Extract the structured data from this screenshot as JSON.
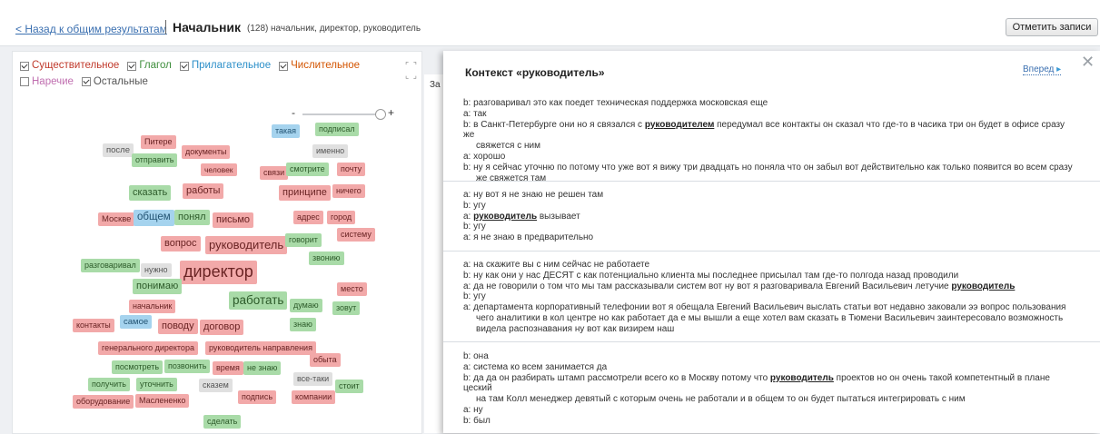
{
  "header": {
    "back_label": "< Назад к общим результатам",
    "title": "Начальник",
    "count": "(128)",
    "synonyms": "начальник, директор, руководитель",
    "mark_button": "Отметить записи"
  },
  "filters": [
    {
      "label": "Существительное",
      "checked": true,
      "color": "#c0392b"
    },
    {
      "label": "Глагол",
      "checked": true,
      "color": "#3e8e3c"
    },
    {
      "label": "Прилагательное",
      "checked": true,
      "color": "#2c8fc9"
    },
    {
      "label": "Числительное",
      "checked": true,
      "color": "#d35400"
    },
    {
      "label": "Наречие",
      "checked": false,
      "color": "#c06fb0"
    },
    {
      "label": "Остальные",
      "checked": true,
      "color": "#555555"
    }
  ],
  "zoom": {
    "minus": "-",
    "plus": "+"
  },
  "cloud": {
    "tags": [
      {
        "text": "такая",
        "color": "blue"
      },
      {
        "text": "подписал",
        "color": "green"
      },
      {
        "text": "Питере",
        "color": "pink"
      },
      {
        "text": "после",
        "color": "gray"
      },
      {
        "text": "документы",
        "color": "pink"
      },
      {
        "text": "именно",
        "color": "gray"
      },
      {
        "text": "отправить",
        "color": "green"
      },
      {
        "text": "человек",
        "color": "pink"
      },
      {
        "text": "связи",
        "color": "pink"
      },
      {
        "text": "смотрите",
        "color": "green"
      },
      {
        "text": "почту",
        "color": "pink"
      },
      {
        "text": "сказать",
        "color": "green"
      },
      {
        "text": "работы",
        "color": "pink"
      },
      {
        "text": "принципе",
        "color": "pink"
      },
      {
        "text": "ничего",
        "color": "pink"
      },
      {
        "text": "Москве",
        "color": "pink"
      },
      {
        "text": "общем",
        "color": "blue"
      },
      {
        "text": "понял",
        "color": "green"
      },
      {
        "text": "письмо",
        "color": "pink"
      },
      {
        "text": "адрес",
        "color": "pink"
      },
      {
        "text": "город",
        "color": "pink"
      },
      {
        "text": "систему",
        "color": "pink"
      },
      {
        "text": "вопрос",
        "color": "pink"
      },
      {
        "text": "руководитель",
        "color": "pink"
      },
      {
        "text": "говорит",
        "color": "green"
      },
      {
        "text": "разговаривал",
        "color": "green"
      },
      {
        "text": "нужно",
        "color": "gray"
      },
      {
        "text": "директор",
        "color": "pink"
      },
      {
        "text": "звонию",
        "color": "green"
      },
      {
        "text": "понимаю",
        "color": "green"
      },
      {
        "text": "место",
        "color": "pink"
      },
      {
        "text": "начальник",
        "color": "pink"
      },
      {
        "text": "работать",
        "color": "green"
      },
      {
        "text": "думаю",
        "color": "green"
      },
      {
        "text": "зовут",
        "color": "green"
      },
      {
        "text": "контакты",
        "color": "pink"
      },
      {
        "text": "самое",
        "color": "blue"
      },
      {
        "text": "поводу",
        "color": "pink"
      },
      {
        "text": "договор",
        "color": "pink"
      },
      {
        "text": "знаю",
        "color": "green"
      },
      {
        "text": "генерального директора",
        "color": "pink"
      },
      {
        "text": "руководитель направления",
        "color": "pink"
      },
      {
        "text": "обыта",
        "color": "pink"
      },
      {
        "text": "посмотреть",
        "color": "green"
      },
      {
        "text": "позвонить",
        "color": "green"
      },
      {
        "text": "время",
        "color": "pink"
      },
      {
        "text": "не знаю",
        "color": "green"
      },
      {
        "text": "все-таки",
        "color": "gray"
      },
      {
        "text": "получить",
        "color": "green"
      },
      {
        "text": "уточнить",
        "color": "green"
      },
      {
        "text": "сказем",
        "color": "gray"
      },
      {
        "text": "стоит",
        "color": "green"
      },
      {
        "text": "подпись",
        "color": "pink"
      },
      {
        "text": "компании",
        "color": "pink"
      },
      {
        "text": "оборудование",
        "color": "pink"
      },
      {
        "text": "Маслененко",
        "color": "pink"
      },
      {
        "text": "сделать",
        "color": "green"
      }
    ]
  },
  "sliver_text": "За",
  "context": {
    "title": "Контекст «руководитель»",
    "next_label": "Вперед",
    "entries": [
      {
        "lines": [
          {
            "speaker": "b:",
            "parts": [
              {
                "t": "разговаривал это как поедет техническая поддержка московская еще"
              }
            ]
          },
          {
            "speaker": "a:",
            "parts": [
              {
                "t": "так"
              }
            ]
          },
          {
            "speaker": "b:",
            "parts": [
              {
                "t": "в Санкт-Петербурге они но я связался с "
              },
              {
                "t": "руководителем",
                "hl": true
              },
              {
                "t": " передумал все контакты он сказал что где-то в часика три он будет в офисе сразу же"
              }
            ]
          },
          {
            "speaker": "",
            "parts": [
              {
                "t": "свяжется с ним"
              }
            ]
          },
          {
            "speaker": "a:",
            "parts": [
              {
                "t": "хорошо"
              }
            ]
          },
          {
            "speaker": "b:",
            "parts": [
              {
                "t": "ну я сейчас уточню по потому что уже вот я вижу три двадцать но поняла что он забыл вот действительно как только появится во всем сразу"
              }
            ]
          },
          {
            "speaker": "",
            "parts": [
              {
                "t": "же свяжется там"
              }
            ]
          }
        ]
      },
      {
        "lines": [
          {
            "speaker": "a:",
            "parts": [
              {
                "t": "ну вот я не знаю не решен там"
              }
            ]
          },
          {
            "speaker": "b:",
            "parts": [
              {
                "t": "угу"
              }
            ]
          },
          {
            "speaker": "a:",
            "parts": [
              {
                "t": "руководитель",
                "hl": true
              },
              {
                "t": " вызывает"
              }
            ]
          },
          {
            "speaker": "b:",
            "parts": [
              {
                "t": "угу"
              }
            ]
          },
          {
            "speaker": "a:",
            "parts": [
              {
                "t": "я не знаю в предварительно"
              }
            ]
          }
        ]
      },
      {
        "lines": [
          {
            "speaker": "a:",
            "parts": [
              {
                "t": "на скажите вы с ним сейчас не работаете"
              }
            ]
          },
          {
            "speaker": "b:",
            "parts": [
              {
                "t": "ну как они у нас ДЕСЯТ с как потенциально клиента мы последнее присылал там где-то полгода назад проводили"
              }
            ]
          },
          {
            "speaker": "a:",
            "parts": [
              {
                "t": "да не говорили о том что мы там рассказывали систем вот ну вот я разговаривала Евгений Васильевич летучие "
              },
              {
                "t": "руководитель",
                "hl": true
              }
            ]
          },
          {
            "speaker": "b:",
            "parts": [
              {
                "t": "угу"
              }
            ]
          },
          {
            "speaker": "a:",
            "parts": [
              {
                "t": "департамента корпоративный телефонии вот я обещала Евгений Васильевич выслать статьи вот недавно заковали ээ вопрос пользования"
              }
            ]
          },
          {
            "speaker": "",
            "parts": [
              {
                "t": "чего аналитики в кол центре но как работает да е мы вышли а еще хотел вам сказать в Тюмени Васильевич заинтересовало возможность"
              }
            ]
          },
          {
            "speaker": "",
            "parts": [
              {
                "t": "видела распознавания ну вот как визирем наш"
              }
            ]
          }
        ]
      },
      {
        "lines": [
          {
            "speaker": "b:",
            "parts": [
              {
                "t": "она"
              }
            ]
          },
          {
            "speaker": "a:",
            "parts": [
              {
                "t": "система ко всем занимается да"
              }
            ]
          },
          {
            "speaker": "b:",
            "parts": [
              {
                "t": "да да он разбирать штамп рассмотрели всего ко в Москву потому что "
              },
              {
                "t": "руководитель",
                "hl": true
              },
              {
                "t": " проектов но он очень такой компетентный в плане цеский"
              }
            ]
          },
          {
            "speaker": "",
            "parts": [
              {
                "t": "на там Колл менеджер девятый с которым очень не работали и в общем то он будет пытаться интегрировать с ним"
              }
            ]
          },
          {
            "speaker": "a:",
            "parts": [
              {
                "t": "ну"
              }
            ]
          },
          {
            "speaker": "b:",
            "parts": [
              {
                "t": "был"
              }
            ]
          }
        ]
      }
    ]
  }
}
